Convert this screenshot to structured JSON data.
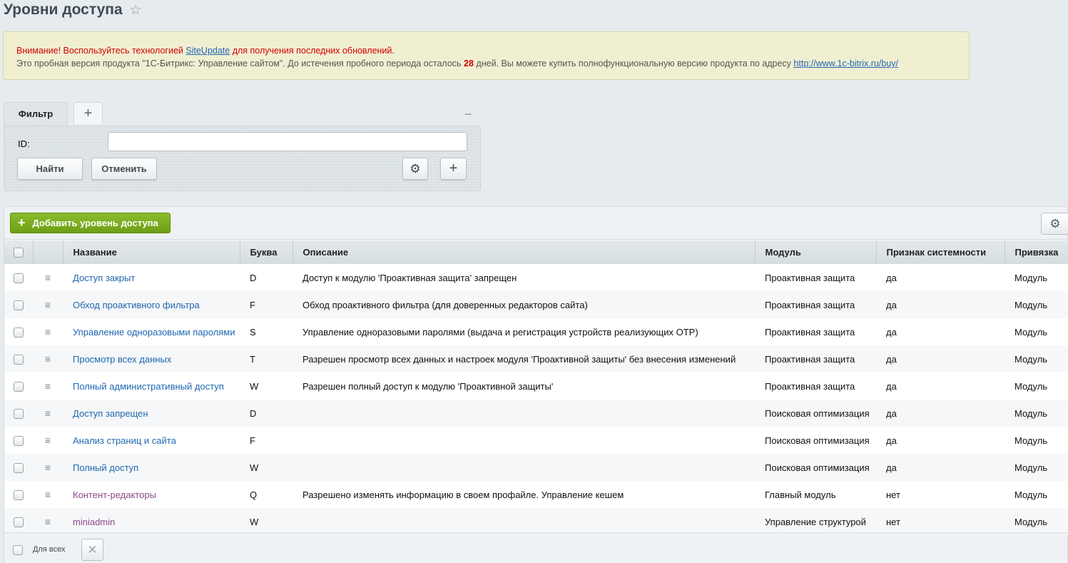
{
  "page": {
    "title": "Уровни доступа",
    "star_icon": "☆"
  },
  "notice": {
    "warning_prefix": "Внимание! Воспользуйтесь технологией ",
    "warning_link": "SiteUpdate",
    "warning_suffix": " для получения последних обновлений.",
    "trial_prefix": "Это пробная версия продукта \"1С-Битрикс: Управление сайтом\". До истечения пробного периода осталось ",
    "trial_days": "28",
    "trial_middle": " дней. Вы можете купить полнофункциональную версию продукта по адресу ",
    "trial_link": "http://www.1c-bitrix.ru/buy/"
  },
  "filter": {
    "tab_label": "Фильтр",
    "add_tab_icon": "+",
    "collapse_icon": "−",
    "id_label": "ID:",
    "id_value": "",
    "find_label": "Найти",
    "cancel_label": "Отменить",
    "gear_icon": "⚙",
    "plus_icon": "+"
  },
  "list": {
    "add_button_icon": "+",
    "add_button_label": "Добавить уровень доступа",
    "settings_icon": "⚙",
    "columns": [
      "Название",
      "Буква",
      "Описание",
      "Модуль",
      "Признак системности",
      "Привязка"
    ],
    "rows": [
      {
        "name": "Доступ закрыт",
        "letter": "D",
        "description": "Доступ к модулю 'Проактивная защита' запрещен",
        "module": "Проактивная защита",
        "system": "да",
        "binding": "Модуль"
      },
      {
        "name": "Обход проактивного фильтра",
        "letter": "F",
        "description": "Обход проактивного фильтра (для доверенных редакторов сайта)",
        "module": "Проактивная защита",
        "system": "да",
        "binding": "Модуль"
      },
      {
        "name": "Управление одноразовыми паролями",
        "letter": "S",
        "description": "Управление одноразовыми паролями (выдача и регистрация устройств реализующих OTP)",
        "module": "Проактивная защита",
        "system": "да",
        "binding": "Модуль"
      },
      {
        "name": "Просмотр всех данных",
        "letter": "T",
        "description": "Разрешен просмотр всех данных и настроек модуля 'Проактивной защиты' без внесения изменений",
        "module": "Проактивная защита",
        "system": "да",
        "binding": "Модуль"
      },
      {
        "name": "Полный административный доступ",
        "letter": "W",
        "description": "Разрешен полный доступ к модулю 'Проактивной защиты'",
        "module": "Проактивная защита",
        "system": "да",
        "binding": "Модуль"
      },
      {
        "name": "Доступ запрещен",
        "letter": "D",
        "description": "",
        "module": "Поисковая оптимизация",
        "system": "да",
        "binding": "Модуль"
      },
      {
        "name": "Анализ страниц и сайта",
        "letter": "F",
        "description": "",
        "module": "Поисковая оптимизация",
        "system": "да",
        "binding": "Модуль"
      },
      {
        "name": "Полный доступ",
        "letter": "W",
        "description": "",
        "module": "Поисковая оптимизация",
        "system": "да",
        "binding": "Модуль"
      },
      {
        "name": "Контент-редакторы",
        "letter": "Q",
        "description": "Разрешено изменять информацию в своем профайле. Управление кешем",
        "module": "Главный модуль",
        "system": "нет",
        "binding": "Модуль"
      },
      {
        "name": "miniadmin",
        "letter": "W",
        "description": "",
        "module": "Управление структурой",
        "system": "нет",
        "binding": "Модуль"
      }
    ],
    "menu_icon": "≡",
    "for_all_label": "Для всех",
    "delete_icon": "✕"
  }
}
